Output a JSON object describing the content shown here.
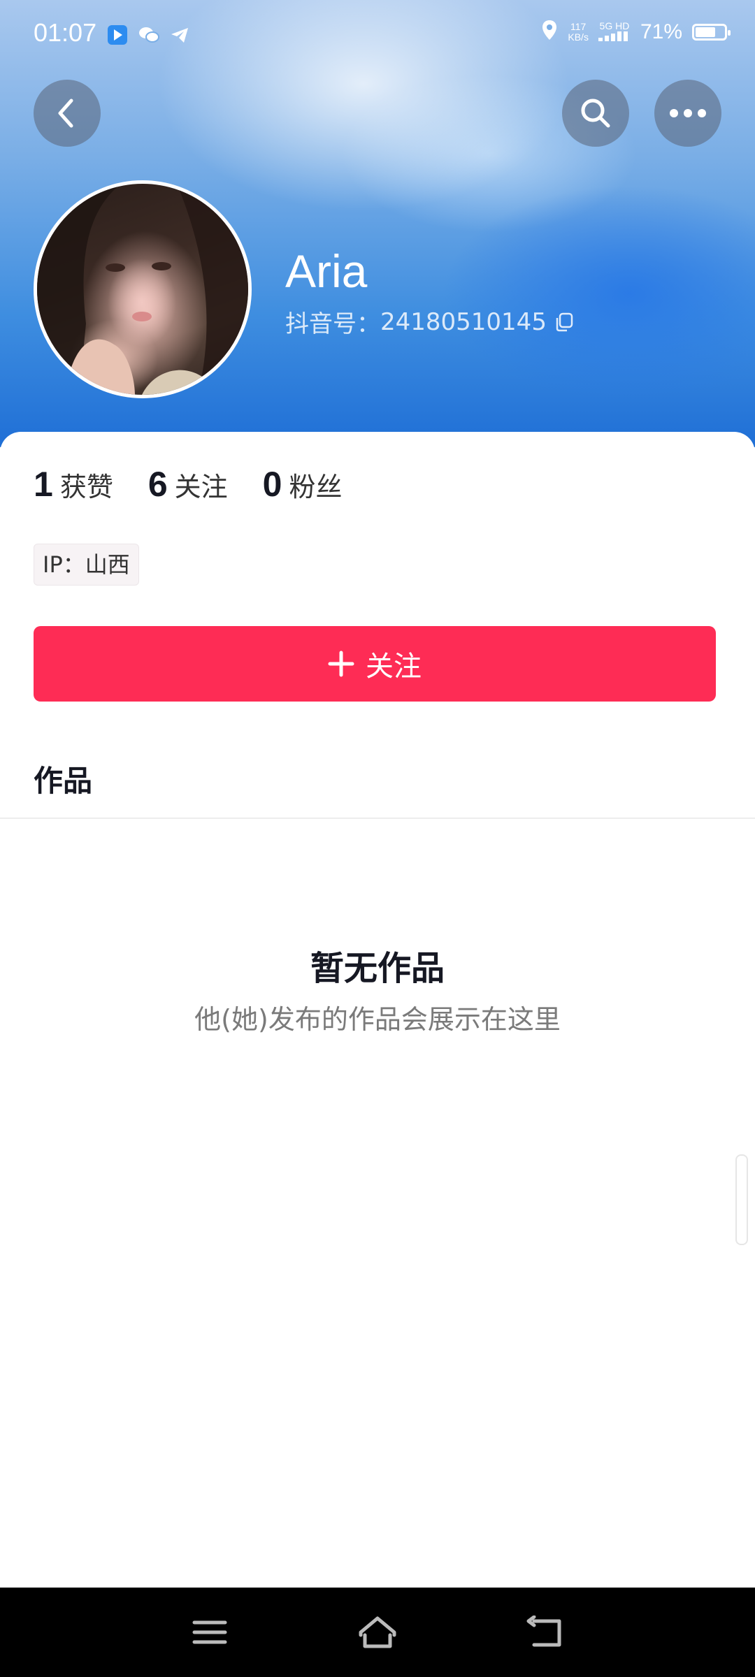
{
  "status_bar": {
    "time": "01:07",
    "net_speed_top": "117",
    "net_speed_bottom": "KB/s",
    "signal_label": "5G HD",
    "battery_percent": "71%",
    "battery_level": 0.71
  },
  "header": {
    "back_icon": "chevron-left-icon",
    "search_icon": "search-icon",
    "more_icon": "more-horizontal-icon"
  },
  "profile": {
    "name": "Aria",
    "id_label": "抖音号：",
    "id_value": "24180510145",
    "copy_icon": "copy-icon"
  },
  "stats": [
    {
      "num": "1",
      "label": "获赞"
    },
    {
      "num": "6",
      "label": "关注"
    },
    {
      "num": "0",
      "label": "粉丝"
    }
  ],
  "ip_tag": "IP：山西",
  "follow_button": {
    "icon": "plus-icon",
    "label": "关注"
  },
  "tabs": {
    "works": "作品"
  },
  "empty_state": {
    "title": "暂无作品",
    "subtitle": "他(她)发布的作品会展示在这里"
  },
  "colors": {
    "accent": "#fe2c55",
    "banner": "#3f8ee0"
  }
}
